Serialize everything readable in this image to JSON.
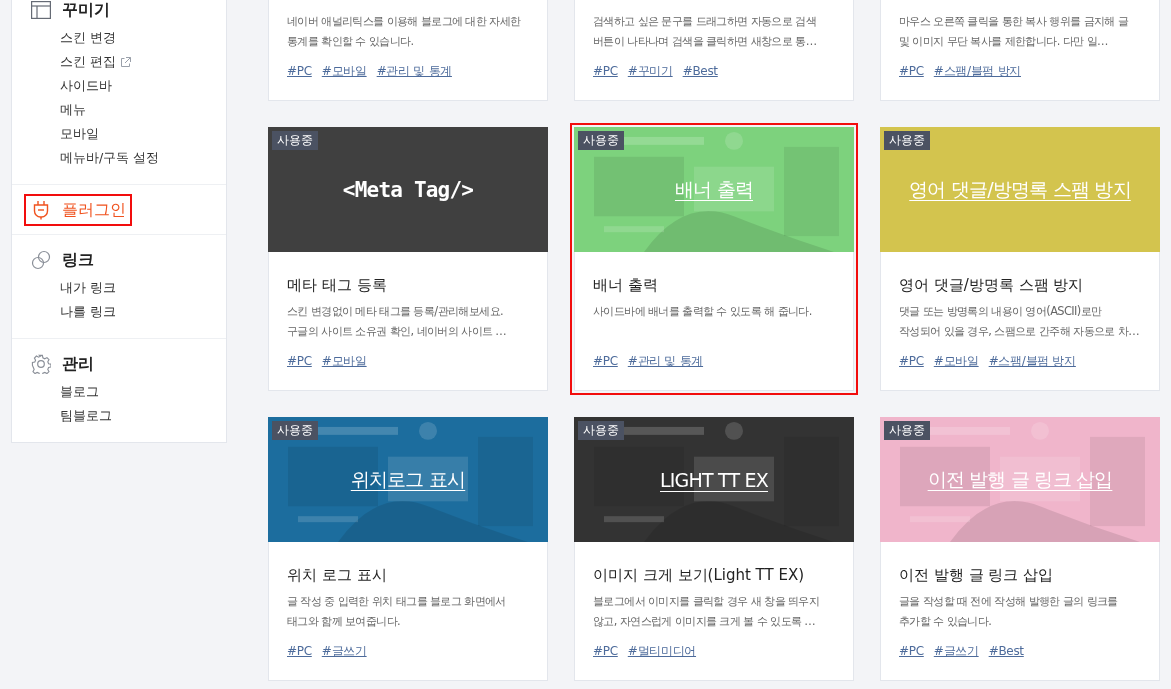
{
  "sidebar": {
    "sections": [
      {
        "title": "꾸미기",
        "selected": false,
        "highlighted": false,
        "items": [
          {
            "label": "스킨 변경",
            "external": false
          },
          {
            "label": "스킨 편집",
            "external": true
          },
          {
            "label": "사이드바",
            "external": false
          },
          {
            "label": "메뉴",
            "external": false
          },
          {
            "label": "모바일",
            "external": false
          },
          {
            "label": "메뉴바/구독 설정",
            "external": false
          }
        ]
      },
      {
        "title": "플러그인",
        "selected": true,
        "highlighted": true
      },
      {
        "title": "링크",
        "selected": false,
        "highlighted": false,
        "items": [
          {
            "label": "내가 링크",
            "external": false
          },
          {
            "label": "나를 링크",
            "external": false
          }
        ]
      },
      {
        "title": "관리",
        "selected": false,
        "highlighted": false,
        "items": [
          {
            "label": "블로그",
            "external": false
          },
          {
            "label": "팀블로그",
            "external": false
          }
        ]
      }
    ]
  },
  "plugins": [
    {
      "description": "네이버 애널리틱스를 이용해 블로그에 대한 자세한 통계를 확인할 수 있습니다.",
      "tags": [
        "#PC",
        "#모바일",
        "#관리 및 통계"
      ],
      "highlighted": false
    },
    {
      "description": "검색하고 싶은 문구를 드래그하면 자동으로 검색 버튼이 나타나며 검색을 클릭하면 새창으로 통…",
      "tags": [
        "#PC",
        "#꾸미기",
        "#Best"
      ],
      "highlighted": false
    },
    {
      "description": "마우스 오른쪽 클릭을 통한 복사 행위를 금지해 글 및 이미지 무단 복사를 제한합니다. 다만 일…",
      "tags": [
        "#PC",
        "#스팸/블펌 방지"
      ],
      "highlighted": false
    },
    {
      "thumb": {
        "kind": "code",
        "label": "<Meta Tag/>",
        "color": "#404040"
      },
      "badge": "사용중",
      "title": "메타 태그 등록",
      "description": "스킨 변경없이 메타 태그를 등록/관리해보세요. 구글의 사이트 소유권 확인, 네이버의 사이트 …",
      "tags": [
        "#PC",
        "#모바일"
      ],
      "highlighted": false
    },
    {
      "thumb": {
        "kind": "picture",
        "label": "배너 출력",
        "color": "#7dd27d"
      },
      "badge": "사용중",
      "title": "배너 출력",
      "description": "사이드바에 배너를 출력할 수 있도록 해 줍니다.",
      "tags": [
        "#PC",
        "#관리 및 통계"
      ],
      "highlighted": true
    },
    {
      "thumb": {
        "kind": "plain",
        "label": "영어 댓글/방명록 스팸 방지",
        "color": "#d3c44e"
      },
      "badge": "사용중",
      "title": "영어 댓글/방명록 스팸 방지",
      "description": "댓글 또는 방명록의 내용이 영어(ASCII)로만 작성되어 있을 경우, 스팸으로 간주해 자동으로 차…",
      "tags": [
        "#PC",
        "#모바일",
        "#스팸/블펌 방지"
      ],
      "highlighted": false
    },
    {
      "thumb": {
        "kind": "picture",
        "label": "위치로그 표시",
        "color": "#1c6d9e"
      },
      "badge": "사용중",
      "title": "위치 로그 표시",
      "description": "글 작성 중 입력한 위치 태그를 블로그 화면에서 태그와 함께 보여줍니다.",
      "tags": [
        "#PC",
        "#글쓰기"
      ],
      "highlighted": false
    },
    {
      "thumb": {
        "kind": "picture",
        "label": "LIGHT TT EX",
        "color": "#333333"
      },
      "badge": "사용중",
      "title": "이미지 크게 보기(Light TT EX)",
      "description": "블로그에서 이미지를 클릭할 경우 새 창을 띄우지 않고, 자연스럽게 이미지를 크게 볼 수 있도록 …",
      "tags": [
        "#PC",
        "#멀티미디어"
      ],
      "highlighted": false
    },
    {
      "thumb": {
        "kind": "picture",
        "label": "이전 발행 글 링크 삽입",
        "color": "#f0b5cb"
      },
      "badge": "사용중",
      "title": "이전 발행 글 링크 삽입",
      "description": "글을 작성할 때 전에 작성해 발행한 글의 링크를 추가할 수 있습니다.",
      "tags": [
        "#PC",
        "#글쓰기",
        "#Best"
      ],
      "highlighted": false
    }
  ]
}
